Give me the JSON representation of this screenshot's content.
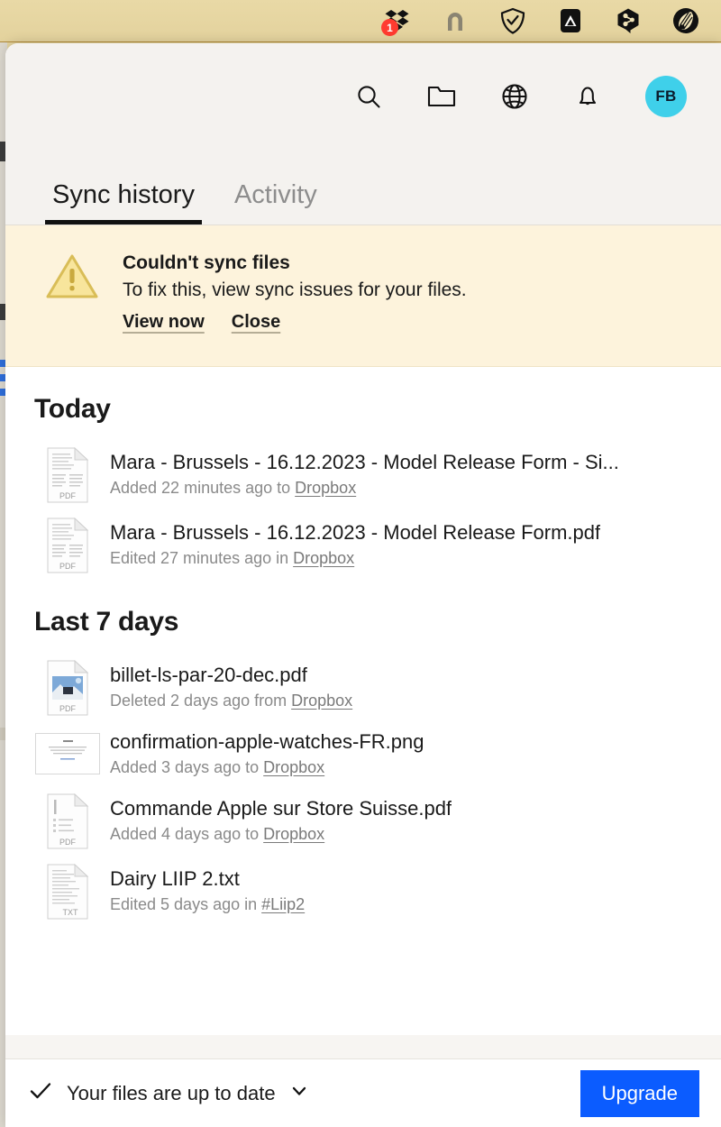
{
  "menubar": {
    "icons": [
      {
        "name": "dropbox-tray-icon",
        "badge": "1"
      },
      {
        "name": "magnet-tray-icon",
        "badge": ""
      },
      {
        "name": "shield-check-tray-icon",
        "badge": ""
      },
      {
        "name": "affinity-tray-icon",
        "badge": ""
      },
      {
        "name": "share-node-tray-icon",
        "badge": ""
      },
      {
        "name": "feather-circle-tray-icon",
        "badge": ""
      }
    ],
    "background_color": "#e6d6a2"
  },
  "toolbar": {
    "search_label": "Search",
    "folder_label": "Files",
    "globe_label": "Web",
    "bell_label": "Notifications",
    "avatar_initials": "FB",
    "avatar_color": "#3fd0ea"
  },
  "tabs": [
    {
      "label": "Sync history",
      "active": true
    },
    {
      "label": "Activity",
      "active": false
    }
  ],
  "banner": {
    "title": "Couldn't sync files",
    "description": "To fix this, view sync issues for your files.",
    "primary_action": "View now",
    "secondary_action": "Close",
    "background_color": "#fdf3dc",
    "icon": "warning-triangle-icon"
  },
  "sections": [
    {
      "title": "Today",
      "files": [
        {
          "name": "Mara - Brussels - 16.12.2023 - Model Release Form - Si...",
          "action": "Added 22 minutes ago to ",
          "location": "Dropbox",
          "icon": "pdf-document-icon",
          "icon_type": "pdf-text"
        },
        {
          "name": "Mara - Brussels - 16.12.2023 - Model Release Form.pdf",
          "action": "Edited 27 minutes ago in ",
          "location": "Dropbox",
          "icon": "pdf-document-icon",
          "icon_type": "pdf-text"
        }
      ]
    },
    {
      "title": "Last 7 days",
      "files": [
        {
          "name": "billet-ls-par-20-dec.pdf",
          "action": "Deleted 2 days ago from ",
          "location": "Dropbox",
          "icon": "pdf-document-icon",
          "icon_type": "pdf-photo"
        },
        {
          "name": "confirmation-apple-watches-FR.png",
          "action": "Added 3 days ago to ",
          "location": "Dropbox",
          "icon": "image-thumbnail-icon",
          "icon_type": "thumb-wide"
        },
        {
          "name": "Commande Apple sur Store Suisse.pdf",
          "action": "Added 4 days ago to ",
          "location": "Dropbox",
          "icon": "pdf-document-icon",
          "icon_type": "pdf-list"
        },
        {
          "name": "Dairy LIIP 2.txt",
          "action": "Edited 5 days ago in ",
          "location": "#Liip2",
          "icon": "txt-document-icon",
          "icon_type": "txt-text"
        }
      ]
    }
  ],
  "footer": {
    "status_text": "Your files are up to date",
    "status_icon": "checkmark-icon",
    "chevron_icon": "chevron-down-icon",
    "upgrade_label": "Upgrade",
    "upgrade_color": "#0b5cff"
  }
}
